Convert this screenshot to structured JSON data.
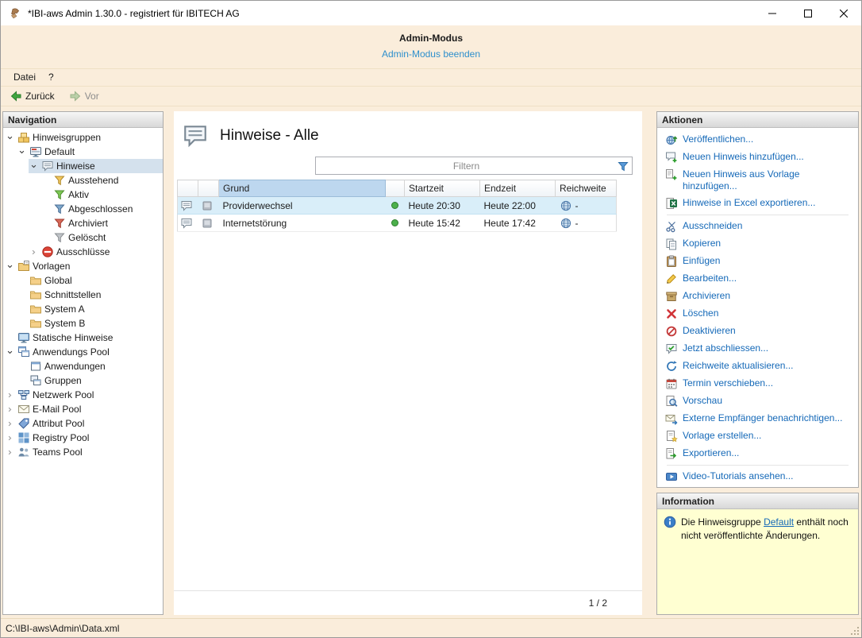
{
  "window": {
    "title": "*IBI-aws Admin 1.30.0 - registriert für IBITECH AG"
  },
  "admin_banner": {
    "title": "Admin-Modus",
    "exit_link": "Admin-Modus beenden"
  },
  "menu_bar": {
    "items": [
      {
        "label": "Datei"
      },
      {
        "label": "?"
      }
    ]
  },
  "toolbar": {
    "back_label": "Zurück",
    "forward_label": "Vor"
  },
  "navigation": {
    "header": "Navigation",
    "items": [
      {
        "label": "Hinweisgruppen",
        "depth": 0,
        "chevron": "expanded",
        "icon": "group-stack-icon"
      },
      {
        "label": "Default",
        "depth": 1,
        "chevron": "expanded",
        "icon": "monitor-icon"
      },
      {
        "label": "Hinweise",
        "depth": 2,
        "chevron": "expanded",
        "icon": "hint-icon",
        "selected": true
      },
      {
        "label": "Ausstehend",
        "depth": 3,
        "chevron": "none",
        "icon": "funnel-yellow-icon"
      },
      {
        "label": "Aktiv",
        "depth": 3,
        "chevron": "none",
        "icon": "funnel-green-icon"
      },
      {
        "label": "Abgeschlossen",
        "depth": 3,
        "chevron": "none",
        "icon": "funnel-blue-icon"
      },
      {
        "label": "Archiviert",
        "depth": 3,
        "chevron": "none",
        "icon": "funnel-red-icon"
      },
      {
        "label": "Gelöscht",
        "depth": 3,
        "chevron": "none",
        "icon": "funnel-gray-icon"
      },
      {
        "label": "Ausschlüsse",
        "depth": 2,
        "chevron": "collapsed",
        "icon": "no-entry-icon"
      },
      {
        "label": "Vorlagen",
        "depth": 0,
        "chevron": "expanded",
        "icon": "templates-icon"
      },
      {
        "label": "Global",
        "depth": 1,
        "chevron": "none",
        "icon": "folder-icon"
      },
      {
        "label": "Schnittstellen",
        "depth": 1,
        "chevron": "none",
        "icon": "folder-icon"
      },
      {
        "label": "System A",
        "depth": 1,
        "chevron": "none",
        "icon": "folder-icon"
      },
      {
        "label": "System B",
        "depth": 1,
        "chevron": "none",
        "icon": "folder-icon"
      },
      {
        "label": "Statische Hinweise",
        "depth": 0,
        "chevron": "none",
        "icon": "static-hints-icon"
      },
      {
        "label": "Anwendungs Pool",
        "depth": 0,
        "chevron": "expanded",
        "icon": "app-pool-icon"
      },
      {
        "label": "Anwendungen",
        "depth": 1,
        "chevron": "none",
        "icon": "application-icon"
      },
      {
        "label": "Gruppen",
        "depth": 1,
        "chevron": "none",
        "icon": "groups-icon"
      },
      {
        "label": "Netzwerk Pool",
        "depth": 0,
        "chevron": "collapsed",
        "icon": "network-icon"
      },
      {
        "label": "E-Mail Pool",
        "depth": 0,
        "chevron": "collapsed",
        "icon": "mail-icon"
      },
      {
        "label": "Attribut Pool",
        "depth": 0,
        "chevron": "collapsed",
        "icon": "attribute-icon"
      },
      {
        "label": "Registry Pool",
        "depth": 0,
        "chevron": "collapsed",
        "icon": "registry-icon"
      },
      {
        "label": "Teams Pool",
        "depth": 0,
        "chevron": "collapsed",
        "icon": "teams-icon"
      }
    ]
  },
  "main": {
    "title": "Hinweise - Alle",
    "filter": {
      "placeholder": "Filtern"
    },
    "table": {
      "columns": [
        {
          "key": "row_icon",
          "label": ""
        },
        {
          "key": "display_icon",
          "label": ""
        },
        {
          "key": "grund",
          "label": "Grund",
          "sorted": true
        },
        {
          "key": "status",
          "label": ""
        },
        {
          "key": "startzeit",
          "label": "Startzeit"
        },
        {
          "key": "endzeit",
          "label": "Endzeit"
        },
        {
          "key": "reichweite",
          "label": "Reichweite"
        }
      ],
      "rows": [
        {
          "grund": "Providerwechsel",
          "status": "active",
          "startzeit": "Heute 20:30",
          "endzeit": "Heute 22:00",
          "reichweite": "-",
          "selected": true
        },
        {
          "grund": "Internetstörung",
          "status": "active",
          "startzeit": "Heute 15:42",
          "endzeit": "Heute 17:42",
          "reichweite": "-",
          "selected": false
        }
      ]
    },
    "page_indicator": "1 / 2"
  },
  "actions": {
    "header": "Aktionen",
    "items": [
      {
        "label": "Veröffentlichen...",
        "icon": "publish-icon"
      },
      {
        "label": "Neuen Hinweis hinzufügen...",
        "icon": "add-hint-icon"
      },
      {
        "label": "Neuen Hinweis aus Vorlage hinzufügen...",
        "icon": "add-from-template-icon"
      },
      {
        "label": "Hinweise in Excel exportieren...",
        "icon": "excel-icon"
      },
      {
        "separator": true
      },
      {
        "label": "Ausschneiden",
        "icon": "scissors-icon"
      },
      {
        "label": "Kopieren",
        "icon": "copy-icon"
      },
      {
        "label": "Einfügen",
        "icon": "paste-icon"
      },
      {
        "label": "Bearbeiten...",
        "icon": "edit-icon"
      },
      {
        "label": "Archivieren",
        "icon": "archive-icon"
      },
      {
        "label": "Löschen",
        "icon": "delete-icon"
      },
      {
        "label": "Deaktivieren",
        "icon": "deactivate-icon"
      },
      {
        "label": "Jetzt abschliessen...",
        "icon": "finish-icon"
      },
      {
        "label": "Reichweite aktualisieren...",
        "icon": "refresh-icon"
      },
      {
        "label": "Termin verschieben...",
        "icon": "calendar-icon"
      },
      {
        "label": "Vorschau",
        "icon": "preview-icon"
      },
      {
        "label": "Externe Empfänger benachrichtigen...",
        "icon": "notify-icon"
      },
      {
        "label": "Vorlage erstellen...",
        "icon": "create-template-icon"
      },
      {
        "label": "Exportieren...",
        "icon": "export-icon"
      },
      {
        "separator": true
      },
      {
        "label": "Video-Tutorials ansehen...",
        "icon": "video-icon"
      }
    ]
  },
  "information": {
    "header": "Information",
    "message": {
      "before": "Die Hinweisgruppe ",
      "link": "Default",
      "after": " enthält noch nicht veröffentlichte Änderungen."
    }
  },
  "status_bar": {
    "path": "C:\\IBI-aws\\Admin\\Data.xml"
  },
  "colors": {
    "workspace_bg": "#FAEDDB",
    "banner_link": "#2E8FCC",
    "accent_link": "#1569B8",
    "selection_row": "#D9EEF9",
    "selection_tree": "#D4E1ED",
    "info_bg": "#FFFFD2",
    "status_active": "#4CB04C"
  }
}
